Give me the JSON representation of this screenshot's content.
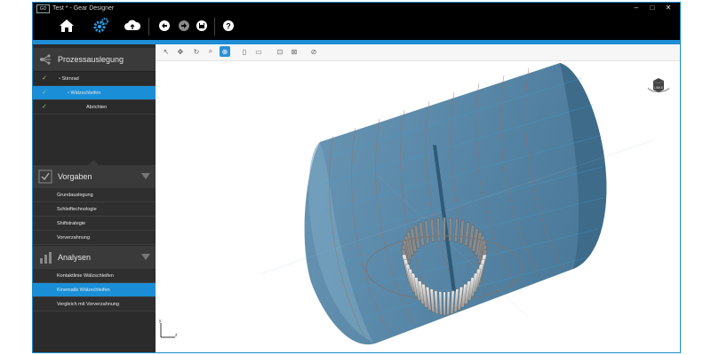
{
  "window": {
    "title": "Test * - Gear Designer",
    "logo_text": "GD",
    "controls": [
      "–",
      "□",
      "✕"
    ]
  },
  "toolbar": {
    "icons": [
      "home-icon",
      "gear-settings-icon",
      "cloud-upload-icon",
      "undo-icon",
      "redo-icon",
      "save-icon",
      "help-icon"
    ]
  },
  "sidebar": {
    "process": {
      "title": "Prozessauslegung",
      "items": [
        {
          "label": "Stirnrad",
          "checked": true,
          "active": false
        },
        {
          "label": "Wälzschleifen",
          "checked": true,
          "active": true
        },
        {
          "label": "Abrichten",
          "checked": true,
          "active": false
        }
      ]
    },
    "vorgaben": {
      "title": "Vorgaben",
      "items": [
        "Grundauslegung",
        "Schleiftechnologie",
        "Shiftstrategie",
        "Vorverzahnung"
      ]
    },
    "analysen": {
      "title": "Analysen",
      "items": [
        "Kontaktlinie Wälzschleifen",
        "Kinematik Wälzschleifen",
        "Vergleich mit Vorverzahnung"
      ],
      "active_index": 1
    }
  },
  "viewport": {
    "tools": [
      "select-arrow-icon",
      "pan-icon",
      "rotate-icon",
      "zoom-icon",
      "zoom-fit-icon",
      "view-front-icon",
      "view-back-icon",
      "wireframe-icon",
      "shaded-icon",
      "section-icon"
    ],
    "active_tool": "zoom-fit-icon",
    "cube_label": "LINKS",
    "axis_labels": {
      "y": "y",
      "z": "z"
    }
  }
}
